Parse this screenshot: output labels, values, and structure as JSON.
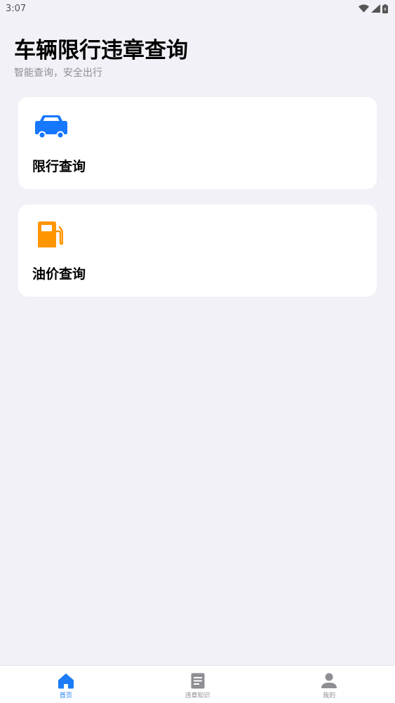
{
  "status_bar": {
    "time": "3:07",
    "icons": [
      "wifi-icon",
      "signal-icon",
      "battery-icon"
    ]
  },
  "header": {
    "title": "车辆限行违章查询",
    "subtitle": "智能查询，安全出行"
  },
  "cards": [
    {
      "label": "限行查询",
      "icon": "car-icon",
      "icon_color": "#1677ff"
    },
    {
      "label": "油价查询",
      "icon": "gas-pump-icon",
      "icon_color": "#ff9500"
    }
  ],
  "tab_bar": {
    "tabs": [
      {
        "label": "首页",
        "icon": "home-icon",
        "active": true
      },
      {
        "label": "违章知识",
        "icon": "document-icon",
        "active": false
      },
      {
        "label": "我的",
        "icon": "person-icon",
        "active": false
      }
    ],
    "active_color": "#1b7cf5",
    "inactive_color": "#8e8e93"
  }
}
